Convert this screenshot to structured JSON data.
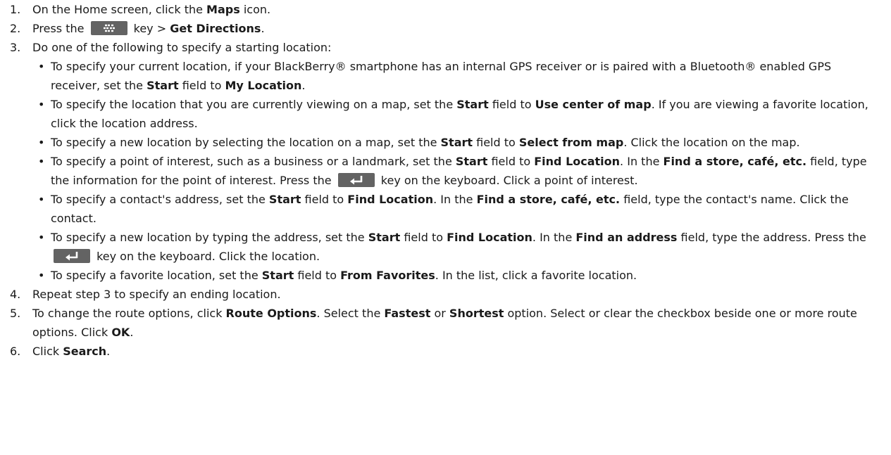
{
  "steps": [
    {
      "num": "1.",
      "parts": [
        {
          "t": "On the Home screen, click the "
        },
        {
          "t": "Maps",
          "b": 1
        },
        {
          "t": " icon."
        }
      ]
    },
    {
      "num": "2.",
      "parts": [
        {
          "t": "Press the "
        },
        {
          "icon": "menu-key-icon"
        },
        {
          "t": " key > "
        },
        {
          "t": "Get Directions",
          "b": 1
        },
        {
          "t": "."
        }
      ]
    },
    {
      "num": "3.",
      "parts": [
        {
          "t": "Do one of the following to specify a starting location:"
        }
      ],
      "bullets": [
        [
          {
            "t": "To specify your current location, if your BlackBerry® smartphone has an internal GPS receiver or is paired with a Bluetooth® enabled GPS receiver, set the "
          },
          {
            "t": "Start",
            "b": 1
          },
          {
            "t": " field to "
          },
          {
            "t": "My Location",
            "b": 1
          },
          {
            "t": "."
          }
        ],
        [
          {
            "t": "To specify the location that you are currently viewing on a map, set the "
          },
          {
            "t": "Start",
            "b": 1
          },
          {
            "t": " field to "
          },
          {
            "t": "Use center of map",
            "b": 1
          },
          {
            "t": ". If you are viewing a favorite location, click the location address."
          }
        ],
        [
          {
            "t": "To specify a new location by selecting the location on a map, set the "
          },
          {
            "t": "Start",
            "b": 1
          },
          {
            "t": " field to "
          },
          {
            "t": "Select from map",
            "b": 1
          },
          {
            "t": ". Click the location on the map."
          }
        ],
        [
          {
            "t": "To specify a point of interest, such as a business or a landmark, set the "
          },
          {
            "t": "Start",
            "b": 1
          },
          {
            "t": " field to "
          },
          {
            "t": "Find Location",
            "b": 1
          },
          {
            "t": ". In the "
          },
          {
            "t": "Find a store, café, etc.",
            "b": 1
          },
          {
            "t": " field, type the information for the point of interest. Press the "
          },
          {
            "icon": "enter-key-icon"
          },
          {
            "t": " key on the keyboard. Click a point of interest."
          }
        ],
        [
          {
            "t": "To specify a contact's address, set the "
          },
          {
            "t": "Start",
            "b": 1
          },
          {
            "t": " field to "
          },
          {
            "t": "Find Location",
            "b": 1
          },
          {
            "t": ". In the "
          },
          {
            "t": "Find a store, café, etc.",
            "b": 1
          },
          {
            "t": " field, type the contact's name. Click the contact."
          }
        ],
        [
          {
            "t": "To specify a new location by typing the address, set the "
          },
          {
            "t": "Start",
            "b": 1
          },
          {
            "t": " field to "
          },
          {
            "t": "Find Location",
            "b": 1
          },
          {
            "t": ". In the "
          },
          {
            "t": "Find an address",
            "b": 1
          },
          {
            "t": " field, type the address. Press the "
          },
          {
            "icon": "enter-key-icon"
          },
          {
            "t": " key on the keyboard. Click the location."
          }
        ],
        [
          {
            "t": "To specify a favorite location, set the "
          },
          {
            "t": "Start",
            "b": 1
          },
          {
            "t": " field to "
          },
          {
            "t": "From Favorites",
            "b": 1
          },
          {
            "t": ". In the list, click a favorite location."
          }
        ]
      ]
    },
    {
      "num": "4.",
      "parts": [
        {
          "t": "Repeat step 3 to specify an ending location."
        }
      ]
    },
    {
      "num": "5.",
      "parts": [
        {
          "t": "To change the route options, click "
        },
        {
          "t": "Route Options",
          "b": 1
        },
        {
          "t": ". Select the "
        },
        {
          "t": "Fastest",
          "b": 1
        },
        {
          "t": " or "
        },
        {
          "t": "Shortest",
          "b": 1
        },
        {
          "t": " option. Select or clear the checkbox beside one or more route options. Click "
        },
        {
          "t": "OK",
          "b": 1
        },
        {
          "t": "."
        }
      ]
    },
    {
      "num": "6.",
      "parts": [
        {
          "t": "Click "
        },
        {
          "t": "Search",
          "b": 1
        },
        {
          "t": "."
        }
      ]
    }
  ],
  "colors": {
    "key_bg": "#636363",
    "key_fg": "#ffffff"
  }
}
